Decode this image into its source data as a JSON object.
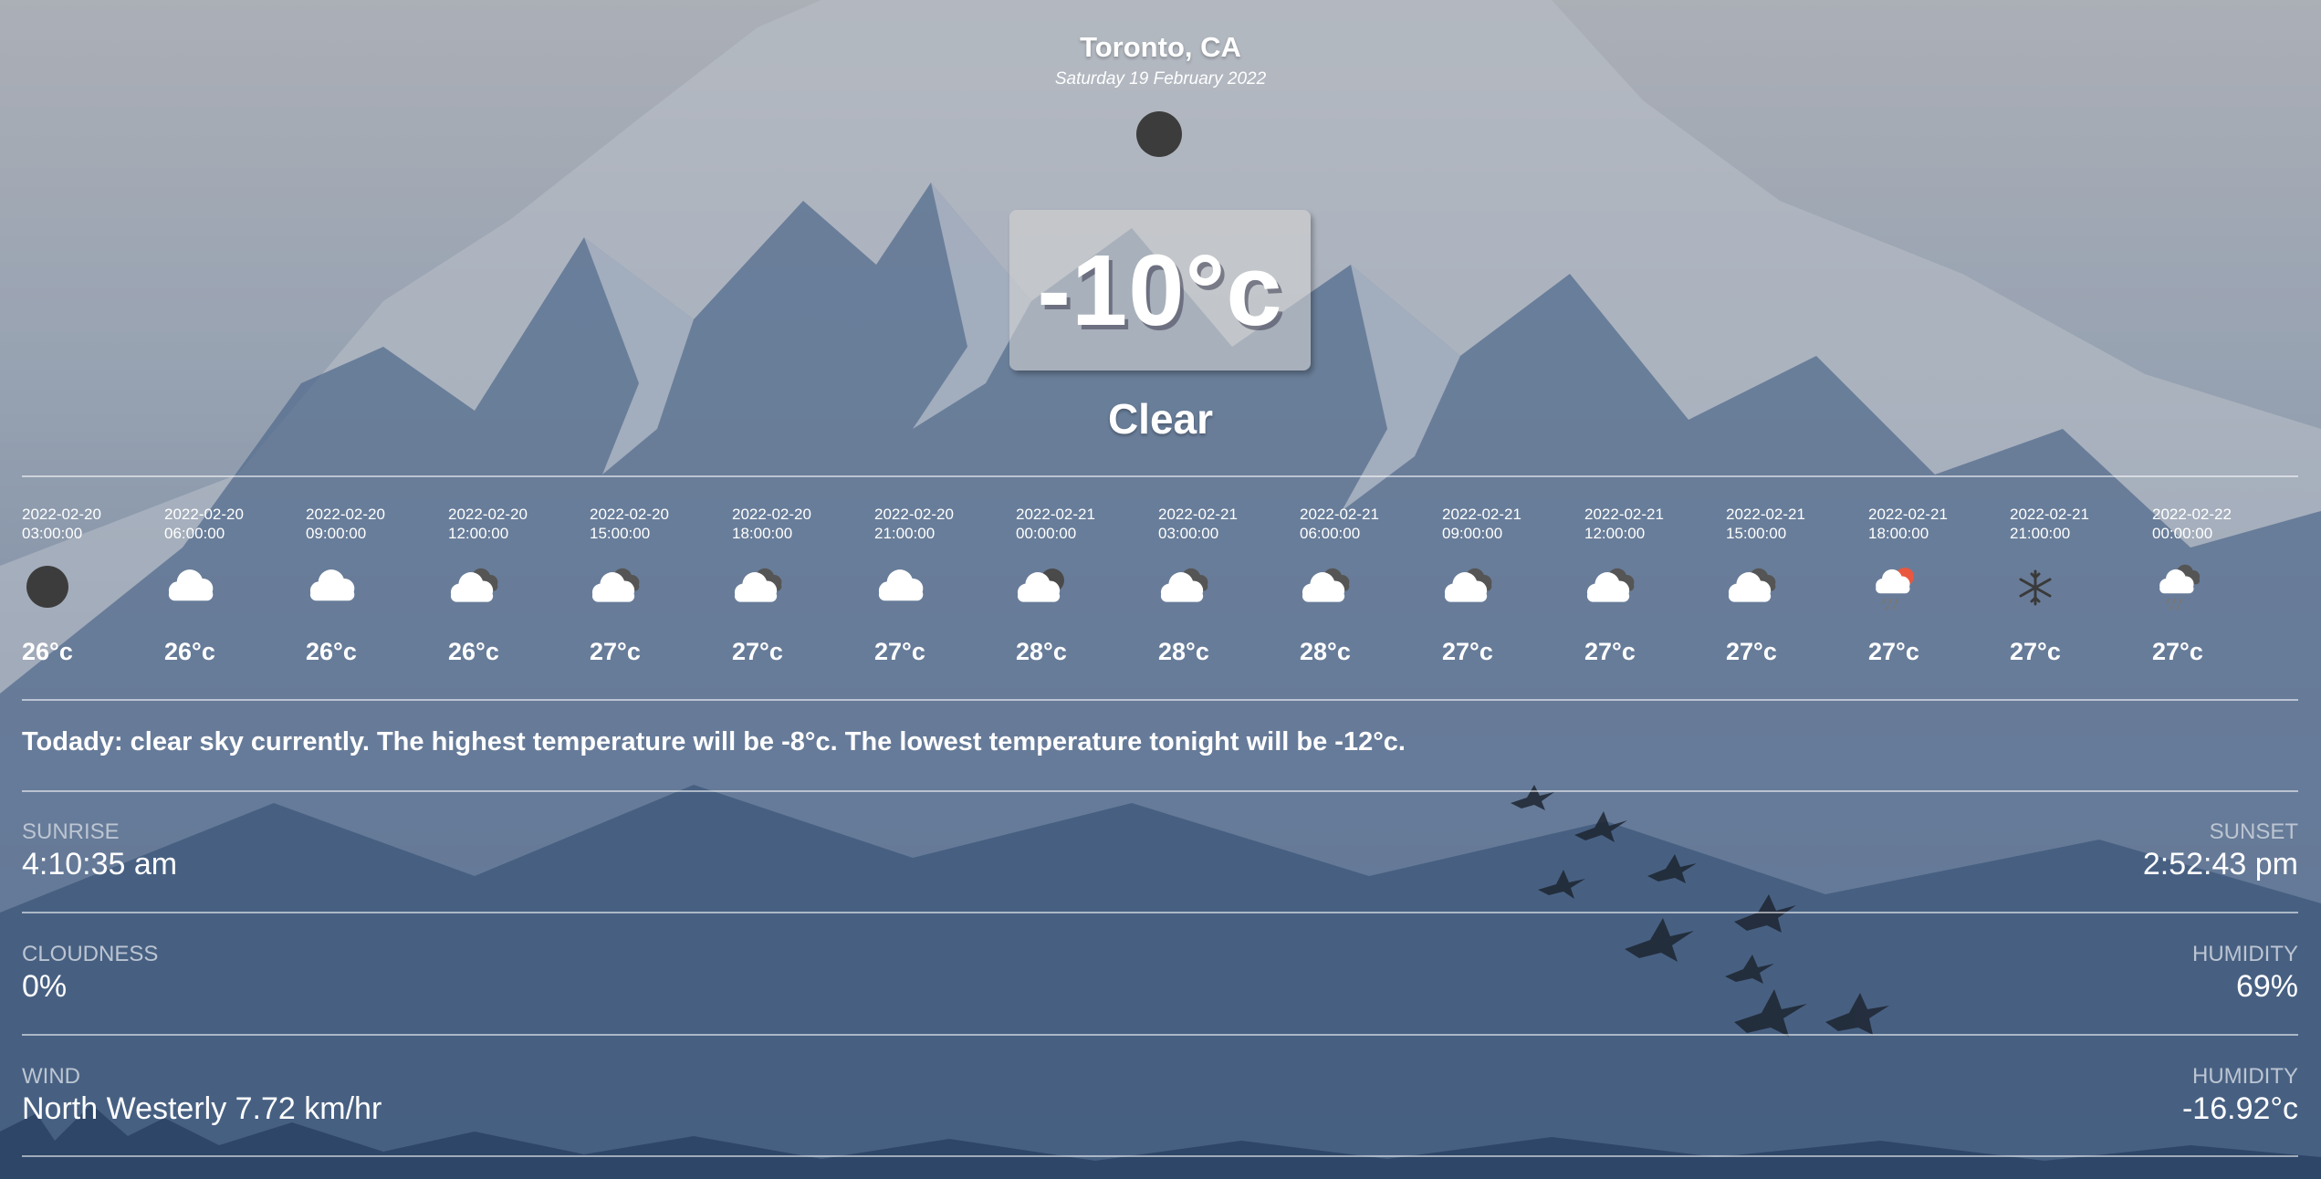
{
  "header": {
    "city": "Toronto, CA",
    "date": "Saturday 19 February 2022"
  },
  "current": {
    "icon": "dark-circle-icon",
    "temperature": "-10°c",
    "condition": "Clear"
  },
  "forecast": [
    {
      "time": "2022-02-20\n03:00:00",
      "icon": "dark-circle-icon",
      "temp": "26°c"
    },
    {
      "time": "2022-02-20\n06:00:00",
      "icon": "cloud-icon",
      "temp": "26°c"
    },
    {
      "time": "2022-02-20\n09:00:00",
      "icon": "cloud-icon",
      "temp": "26°c"
    },
    {
      "time": "2022-02-20\n12:00:00",
      "icon": "cloud-dark-cloud-icon",
      "temp": "26°c"
    },
    {
      "time": "2022-02-20\n15:00:00",
      "icon": "cloud-dark-cloud-icon",
      "temp": "27°c"
    },
    {
      "time": "2022-02-20\n18:00:00",
      "icon": "cloud-dark-cloud-icon",
      "temp": "27°c"
    },
    {
      "time": "2022-02-20\n21:00:00",
      "icon": "cloud-icon",
      "temp": "27°c"
    },
    {
      "time": "2022-02-21\n00:00:00",
      "icon": "cloud-dark-sun-icon",
      "temp": "28°c"
    },
    {
      "time": "2022-02-21\n03:00:00",
      "icon": "cloud-dark-cloud-icon",
      "temp": "28°c"
    },
    {
      "time": "2022-02-21\n06:00:00",
      "icon": "cloud-dark-cloud-icon",
      "temp": "28°c"
    },
    {
      "time": "2022-02-21\n09:00:00",
      "icon": "cloud-dark-cloud-icon",
      "temp": "27°c"
    },
    {
      "time": "2022-02-21\n12:00:00",
      "icon": "cloud-dark-cloud-icon",
      "temp": "27°c"
    },
    {
      "time": "2022-02-21\n15:00:00",
      "icon": "cloud-dark-cloud-icon",
      "temp": "27°c"
    },
    {
      "time": "2022-02-21\n18:00:00",
      "icon": "rain-sun-icon",
      "temp": "27°c"
    },
    {
      "time": "2022-02-21\n21:00:00",
      "icon": "snowflake-icon",
      "temp": "27°c"
    },
    {
      "time": "2022-02-22\n00:00:00",
      "icon": "rain-cloud-icon",
      "temp": "27°c"
    }
  ],
  "today": "Todady: clear sky currently. The highest temperature will be -8°c. The lowest temperature tonight will be -12°c.",
  "details": {
    "sunrise_label": "SUNRISE",
    "sunrise": "4:10:35 am",
    "sunset_label": "SUNSET",
    "sunset": "2:52:43 pm",
    "cloudness_label": "CLOUDNESS",
    "cloudness": "0%",
    "humidity_label": "HUMIDITY",
    "humidity": "69%",
    "wind_label": "WIND",
    "wind": "North Westerly 7.72 km/hr",
    "humidity2_label": "HUMIDITY",
    "humidity2": "-16.92°c"
  },
  "colors": {
    "dark_icon": "#3c3c3c",
    "cloud_white": "#ffffff",
    "sun_red": "#e9573f",
    "snow": "#3a3a3a"
  }
}
